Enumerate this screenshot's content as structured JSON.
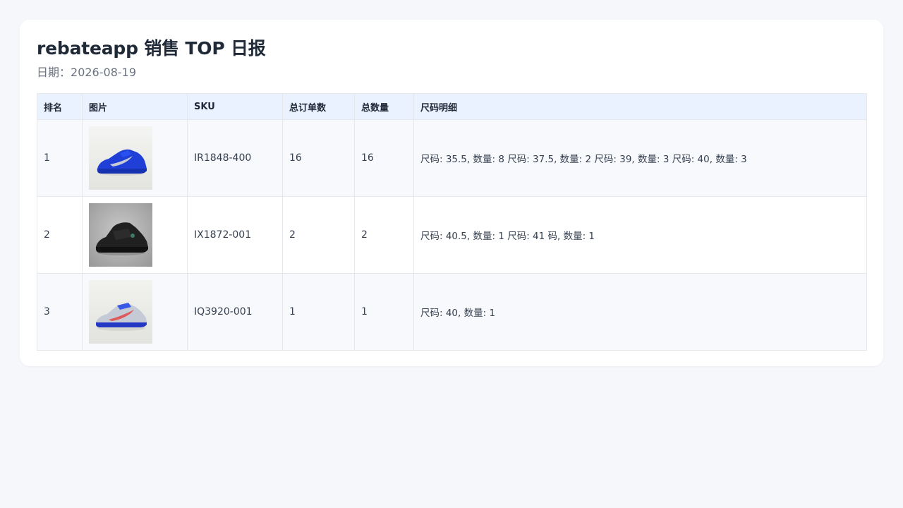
{
  "report": {
    "title": "rebateapp 销售 TOP 日报",
    "date_label": "日期：",
    "date": "2026-08-19"
  },
  "table": {
    "headers": {
      "rank": "排名",
      "image": "图片",
      "sku": "SKU",
      "orders": "总订单数",
      "quantity": "总数量",
      "sizes": "尺码明细"
    },
    "rows": [
      {
        "rank": "1",
        "image_icon": "blue-sneaker-thumbnail",
        "sku": "IR1848-400",
        "orders": "16",
        "quantity": "16",
        "sizes": "尺码: 35.5, 数量: 8 尺码: 37.5, 数量: 2 尺码: 39, 数量: 3 尺码: 40, 数量: 3"
      },
      {
        "rank": "2",
        "image_icon": "black-sneaker-thumbnail",
        "sku": "IX1872-001",
        "orders": "2",
        "quantity": "2",
        "sizes": "尺码: 40.5, 数量: 1 尺码: 41 码, 数量: 1"
      },
      {
        "rank": "3",
        "image_icon": "white-blue-sneaker-thumbnail",
        "sku": "IQ3920-001",
        "orders": "1",
        "quantity": "1",
        "sizes": "尺码: 40, 数量: 1"
      }
    ]
  },
  "colors": {
    "page_bg": "#f5f7fb",
    "card_bg": "#ffffff",
    "header_bg": "#eaf2ff",
    "row_alt_bg": "#f7f9fc",
    "border": "#e5e7eb",
    "muted_text": "#6b7280"
  }
}
